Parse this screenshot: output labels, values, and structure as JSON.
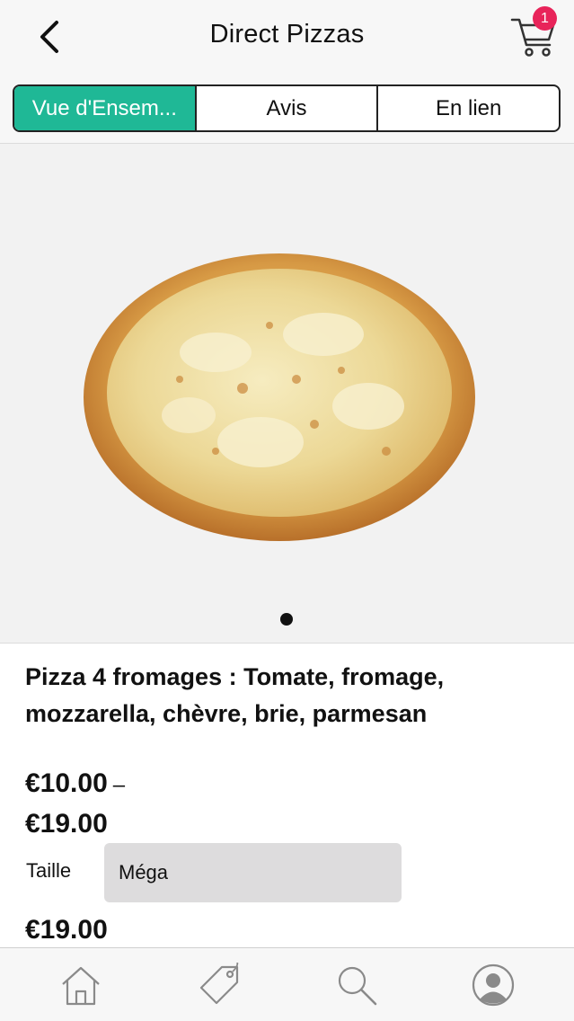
{
  "header": {
    "title": "Direct Pizzas",
    "back_icon": "chevron-left-icon",
    "cart_icon": "cart-icon",
    "cart_count": "1",
    "badge_color": "#e8245a"
  },
  "tabs": [
    {
      "label": "Vue d'Ensem...",
      "active": true
    },
    {
      "label": "Avis",
      "active": false
    },
    {
      "label": "En lien",
      "active": false
    }
  ],
  "accent_color": "#1fb896",
  "gallery": {
    "image": "pizza-4-fromages-image",
    "page_index": 1,
    "page_count": 1
  },
  "product": {
    "name": "Pizza 4 fromages : Tomate, fromage, mozzarella, chèvre, brie, parmesan",
    "price_min": "€10.00",
    "price_separator": "–",
    "price_max": "€19.00",
    "size_label": "Taille",
    "size_value": "Méga",
    "current_price": "€19.00"
  },
  "bottom_nav": [
    {
      "name": "home-icon"
    },
    {
      "name": "tag-icon"
    },
    {
      "name": "search-icon"
    },
    {
      "name": "account-icon"
    }
  ]
}
